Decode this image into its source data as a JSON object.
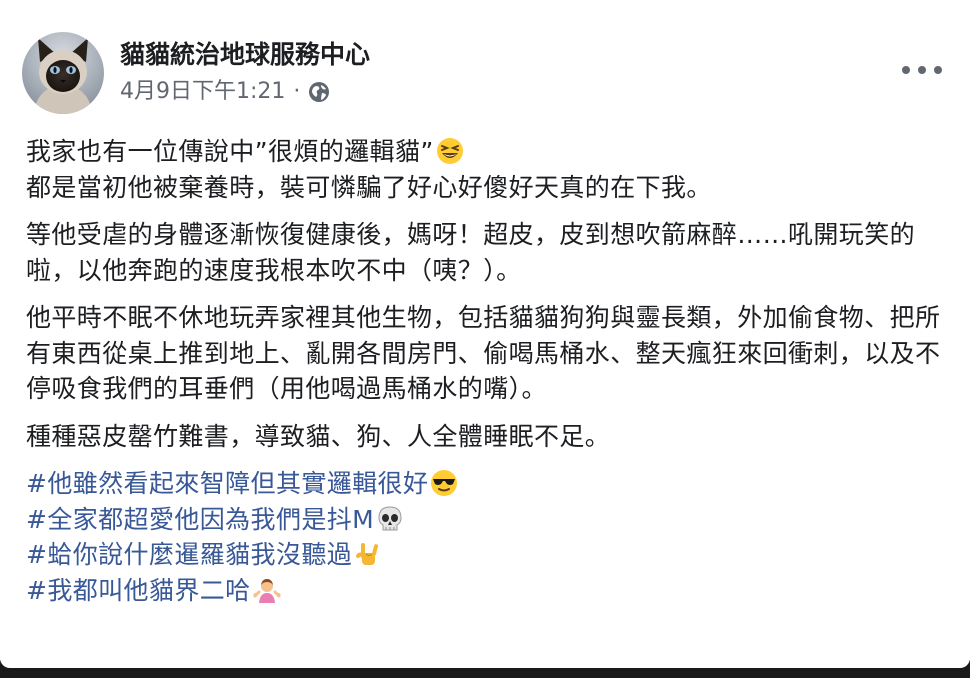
{
  "post": {
    "author": "貓貓統治地球服務中心",
    "timestamp": "4月9日下午1:21",
    "separator": "·",
    "privacy_icon": "globe-icon",
    "more_icon": "more-options-icon"
  },
  "content": {
    "p1": {
      "line1": "我家也有一位傳說中”很煩的邏輯貓”",
      "line1_emoji": "grinning-squinting-face-emoji",
      "line2": "都是當初他被棄養時，裝可憐騙了好心好傻好天真的在下我。"
    },
    "p2": "等他受虐的身體逐漸恢復健康後，媽呀！超皮，皮到想吹箭麻醉……吼開玩笑的啦，以他奔跑的速度我根本吹不中（咦？）。",
    "p3": "他平時不眠不休地玩弄家裡其他生物，包括貓貓狗狗與靈長類，外加偷食物、把所有東西從桌上推到地上、亂開各間房門、偷喝馬桶水、整天瘋狂來回衝刺，以及不停吸食我們的耳垂們（用他喝過馬桶水的嘴）。",
    "p4": "種種惡皮罄竹難書，導致貓、狗、人全體睡眠不足。",
    "hashtags": [
      {
        "text": "#他雖然看起來智障但其實邏輯很好",
        "emoji": "sunglasses-face-emoji"
      },
      {
        "text": "#全家都超愛他因為我們是抖M",
        "emoji": "skull-emoji"
      },
      {
        "text": "#蛤你說什麼暹羅貓我沒聽過",
        "emoji": "sign-of-horns-emoji"
      },
      {
        "text": "#我都叫他貓界二哈",
        "emoji": "person-shrugging-emoji"
      }
    ]
  },
  "colors": {
    "link": "#385898",
    "text": "#1c1e21",
    "secondary": "#606770"
  }
}
